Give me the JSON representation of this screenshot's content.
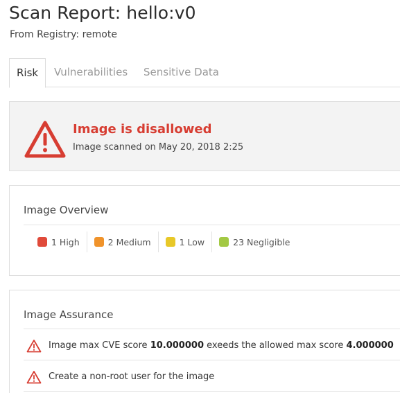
{
  "header": {
    "title": "Scan Report: hello:v0",
    "subtitle": "From Registry: remote"
  },
  "tabs": [
    {
      "label": "Risk",
      "active": true
    },
    {
      "label": "Vulnerabilities",
      "active": false
    },
    {
      "label": "Sensitive Data",
      "active": false
    }
  ],
  "risk": {
    "icon": "warning-triangle-icon",
    "title": "Image is disallowed",
    "scanned": "Image scanned on May 20, 2018 2:25",
    "color": "#d73d32"
  },
  "overview": {
    "title": "Image Overview",
    "severities": [
      {
        "label": "1 High",
        "color": "#e04a3a"
      },
      {
        "label": "2 Medium",
        "color": "#f0932b"
      },
      {
        "label": "1 Low",
        "color": "#e8c828"
      },
      {
        "label": "23 Negligible",
        "color": "#a3c944"
      }
    ]
  },
  "assurance": {
    "title": "Image Assurance",
    "items": [
      {
        "icon": "warning-triangle-icon",
        "text_1": "Image max CVE score ",
        "value_1": "10.000000",
        "text_2": " exeeds the allowed max score ",
        "value_2": "4.000000"
      },
      {
        "icon": "warning-triangle-icon",
        "text_1": "Create a non-root user for the image"
      }
    ]
  }
}
